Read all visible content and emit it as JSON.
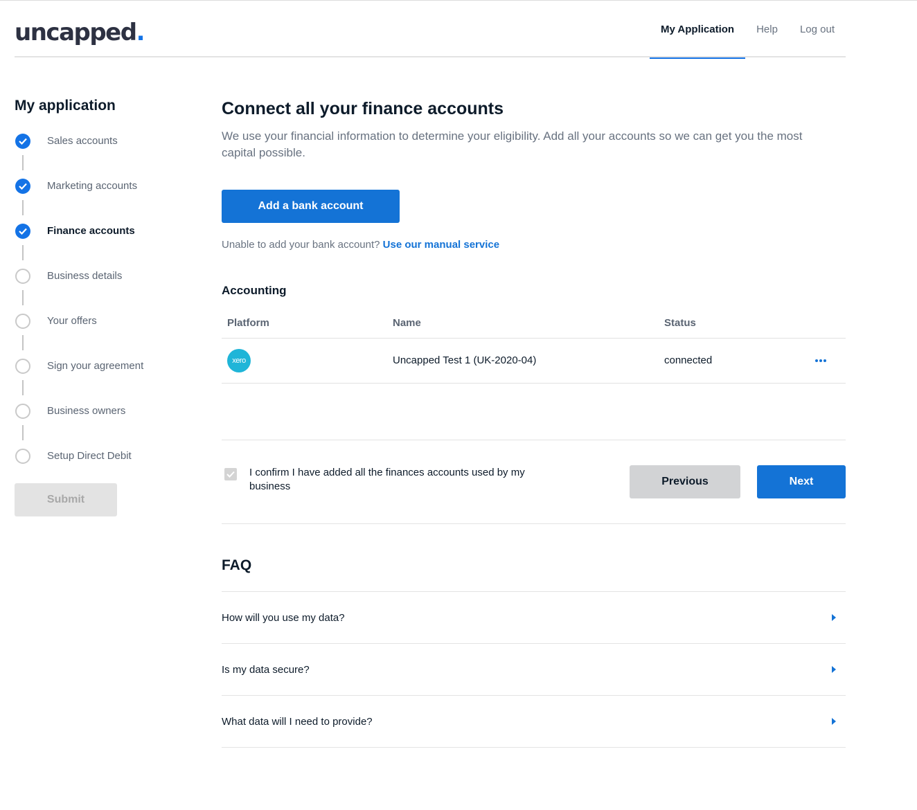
{
  "header": {
    "logo_text": "uncapped",
    "logo_dot": ".",
    "nav": [
      {
        "label": "My Application",
        "active": true
      },
      {
        "label": "Help",
        "active": false
      },
      {
        "label": "Log out",
        "active": false
      }
    ]
  },
  "sidebar": {
    "title": "My application",
    "steps": [
      {
        "label": "Sales accounts",
        "state": "done"
      },
      {
        "label": "Marketing accounts",
        "state": "done"
      },
      {
        "label": "Finance accounts",
        "state": "done",
        "current": true
      },
      {
        "label": "Business details",
        "state": "todo"
      },
      {
        "label": "Your offers",
        "state": "todo"
      },
      {
        "label": "Sign your agreement",
        "state": "todo"
      },
      {
        "label": "Business owners",
        "state": "todo"
      },
      {
        "label": "Setup Direct Debit",
        "state": "todo"
      }
    ],
    "submit_label": "Submit"
  },
  "main": {
    "title": "Connect all your finance accounts",
    "intro": "We use your financial information to determine your eligibility. Add all your accounts so we can get you the most capital possible.",
    "add_bank_label": "Add a bank account",
    "manual_prefix": "Unable to add your bank account?",
    "manual_link": "Use our manual service",
    "accounting": {
      "title": "Accounting",
      "columns": [
        "Platform",
        "Name",
        "Status"
      ],
      "rows": [
        {
          "platform": "xero",
          "name": "Uncapped Test 1 (UK-2020-04)",
          "status": "connected"
        }
      ]
    },
    "confirm": {
      "checked": true,
      "text": "I confirm I have added all the finances accounts used by my business"
    },
    "previous_label": "Previous",
    "next_label": "Next",
    "faq": {
      "title": "FAQ",
      "items": [
        {
          "question": "How will you use my data?"
        },
        {
          "question": "Is my data secure?"
        },
        {
          "question": "What data will I need to provide?"
        }
      ]
    }
  },
  "colors": {
    "accent": "#1473d6",
    "connected": "#1eaa58",
    "xero": "#1fb5d8"
  }
}
